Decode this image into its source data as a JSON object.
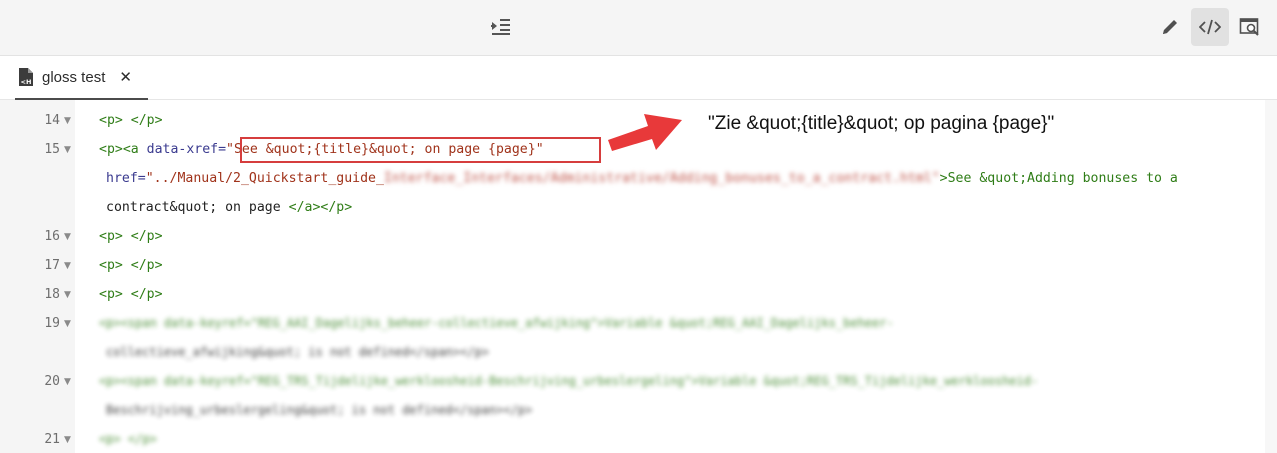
{
  "toolbar": {
    "indent_icon": "indent-icon",
    "edit_icon": "pencil-icon",
    "source_icon": "code-icon",
    "preview_icon": "preview-icon"
  },
  "tab": {
    "label": "gloss test",
    "close": "✕",
    "icon": "html-file-icon"
  },
  "lines": [
    {
      "num": "14"
    },
    {
      "num": "15"
    },
    {
      "num": "16"
    },
    {
      "num": "17"
    },
    {
      "num": "18"
    },
    {
      "num": "19"
    },
    {
      "num": "20"
    },
    {
      "num": "21"
    }
  ],
  "code": {
    "p_empty_open": "<p>",
    "p_empty_close": " </p>",
    "line15_open": "<p><a",
    "line15_attr": " data-xref=",
    "line15_value": "\"See &quot;{title}&quot; on page {page}\"",
    "line15b_attr": "href=",
    "line15b_value": "\"../Manual/2_Quickstart_guide_",
    "line15b_text": ">See &quot;Adding bonuses to a",
    "line15c_text": "contract&quot; on page ",
    "line15c_tags": "</a></p>",
    "blur19a": "<p><span data-keyref=\"REG_AAI_Dagelijks_beheer-collectieve_afwijking\">Variable &quot;REG_AAI_Dagelijks_beheer-",
    "blur19b": "collectieve_afwijking&quot; is not defined</span></p>",
    "blur20a": "<p><span data-keyref=\"REG_TRS_Tijdelijke_werkloosheid-Beschrijving_urbeslergeling\">Variable &quot;REG_TRS_Tijdelijke_werkloosheid-",
    "blur20b": "Beschrijving_urbeslergeling&quot; is not defined</span></p>",
    "blur21": "<p> </p>",
    "blur15_path": "Interface_Interfaces/Administrative/Adding_bonuses_to_a_contract.html\""
  },
  "annotation": {
    "text": "\"Zie &quot;{title}&quot; op pagina {page}\"",
    "arrow_color": "#e8393a"
  },
  "colors": {
    "highlight": "#d63d3d",
    "tag": "#2f7d17",
    "attr": "#3a3a8f",
    "string": "#a0331b"
  }
}
